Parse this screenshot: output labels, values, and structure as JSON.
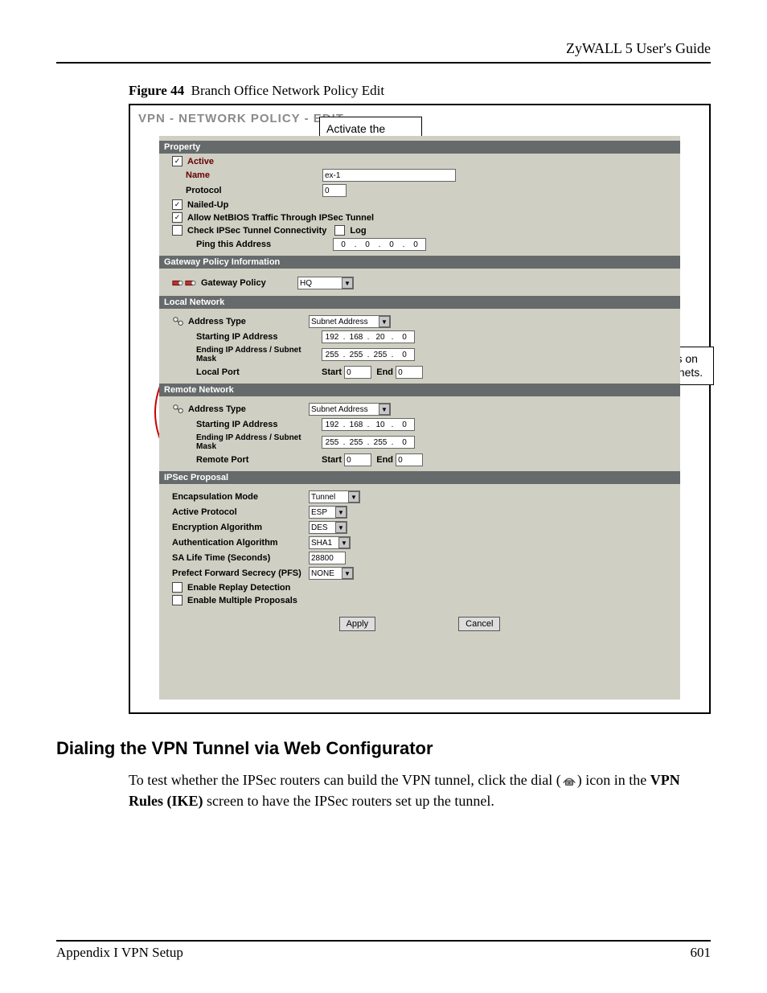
{
  "header": {
    "guide": "ZyWALL 5 User's Guide"
  },
  "figure": {
    "label": "Figure 44",
    "caption": "Branch Office Network Policy Edit"
  },
  "panel": {
    "title": "VPN - NETWORK POLICY - EDIT"
  },
  "callouts": {
    "activate": "Activate the network policy.",
    "subnets": "IP addresses on different subnets."
  },
  "sections": {
    "property": "Property",
    "gateway": "Gateway Policy Information",
    "local": "Local Network",
    "remote": "Remote Network",
    "ipsec": "IPSec Proposal"
  },
  "property": {
    "active_label": "Active",
    "active_checked": "✓",
    "name_label": "Name",
    "name_value": "ex-1",
    "protocol_label": "Protocol",
    "protocol_value": "0",
    "nailed_label": "Nailed-Up",
    "nailed_checked": "✓",
    "netbios_label": "Allow NetBIOS Traffic Through IPSec Tunnel",
    "netbios_checked": "✓",
    "check_conn_label": "Check IPSec Tunnel Connectivity",
    "check_conn_checked": "",
    "log_label": "Log",
    "log_checked": "",
    "ping_label": "Ping this Address",
    "ping_ip": [
      "0",
      "0",
      "0",
      "0"
    ]
  },
  "gateway": {
    "label": "Gateway Policy",
    "value": "HQ"
  },
  "local": {
    "addr_type_label": "Address Type",
    "addr_type_value": "Subnet Address",
    "start_label": "Starting IP Address",
    "start_ip": [
      "192",
      "168",
      "20",
      "0"
    ],
    "end_label": "Ending IP Address / Subnet Mask",
    "end_ip": [
      "255",
      "255",
      "255",
      "0"
    ],
    "port_label": "Local Port",
    "port_start_lbl": "Start",
    "port_start": "0",
    "port_end_lbl": "End",
    "port_end": "0"
  },
  "remote": {
    "addr_type_label": "Address Type",
    "addr_type_value": "Subnet Address",
    "start_label": "Starting IP Address",
    "start_ip": [
      "192",
      "168",
      "10",
      "0"
    ],
    "end_label": "Ending IP Address / Subnet Mask",
    "end_ip": [
      "255",
      "255",
      "255",
      "0"
    ],
    "port_label": "Remote Port",
    "port_start_lbl": "Start",
    "port_start": "0",
    "port_end_lbl": "End",
    "port_end": "0"
  },
  "ipsec": {
    "encap_label": "Encapsulation Mode",
    "encap_value": "Tunnel",
    "proto_label": "Active Protocol",
    "proto_value": "ESP",
    "enc_label": "Encryption Algorithm",
    "enc_value": "DES",
    "auth_label": "Authentication Algorithm",
    "auth_value": "SHA1",
    "life_label": "SA Life Time (Seconds)",
    "life_value": "28800",
    "pfs_label": "Prefect Forward Secrecy (PFS)",
    "pfs_value": "NONE",
    "replay_label": "Enable Replay Detection",
    "replay_checked": "",
    "multi_label": "Enable Multiple Proposals",
    "multi_checked": ""
  },
  "buttons": {
    "apply": "Apply",
    "cancel": "Cancel"
  },
  "body": {
    "h2": "Dialing the VPN Tunnel via Web Configurator",
    "p1a": "To test whether the IPSec routers can build the VPN tunnel, click the dial (",
    "p1b": ") icon in the ",
    "p1c": "VPN Rules (IKE)",
    "p1d": " screen to have the IPSec routers set up the tunnel."
  },
  "footer": {
    "left": "Appendix I VPN Setup",
    "right": "601"
  }
}
